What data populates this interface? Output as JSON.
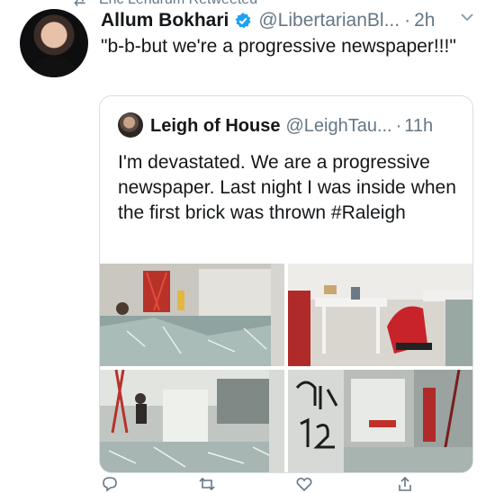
{
  "retweet": {
    "text": "Eric Lendrum Retweeted",
    "icon": "retweet-icon"
  },
  "tweet": {
    "author_name": "Allum Bokhari",
    "verified": true,
    "handle": "@LibertarianBl...",
    "separator": "·",
    "time": "2h",
    "text": "\"b-b-but we're a progressive newspaper!!!\"",
    "menu_icon": "chevron-down-icon"
  },
  "quoted_tweet": {
    "author_name": "Leigh of House",
    "handle": "@LeighTau...",
    "separator": "·",
    "time": "11h",
    "text": "I'm devastated. We are a progressive newspaper. Last night I was inside when the first brick was thrown #Raleigh",
    "photos": [
      "storefront-smashed-glass",
      "office-overturned-chair",
      "lobby-broken-glass",
      "graffiti-window"
    ]
  },
  "actions": {
    "reply_icon": "reply-icon",
    "retweet_icon": "retweet-icon",
    "like_icon": "heart-icon",
    "share_icon": "share-icon"
  },
  "colors": {
    "text": "#14171a",
    "secondary": "#657786",
    "verified": "#1da1f2",
    "border": "#d8dee3"
  }
}
